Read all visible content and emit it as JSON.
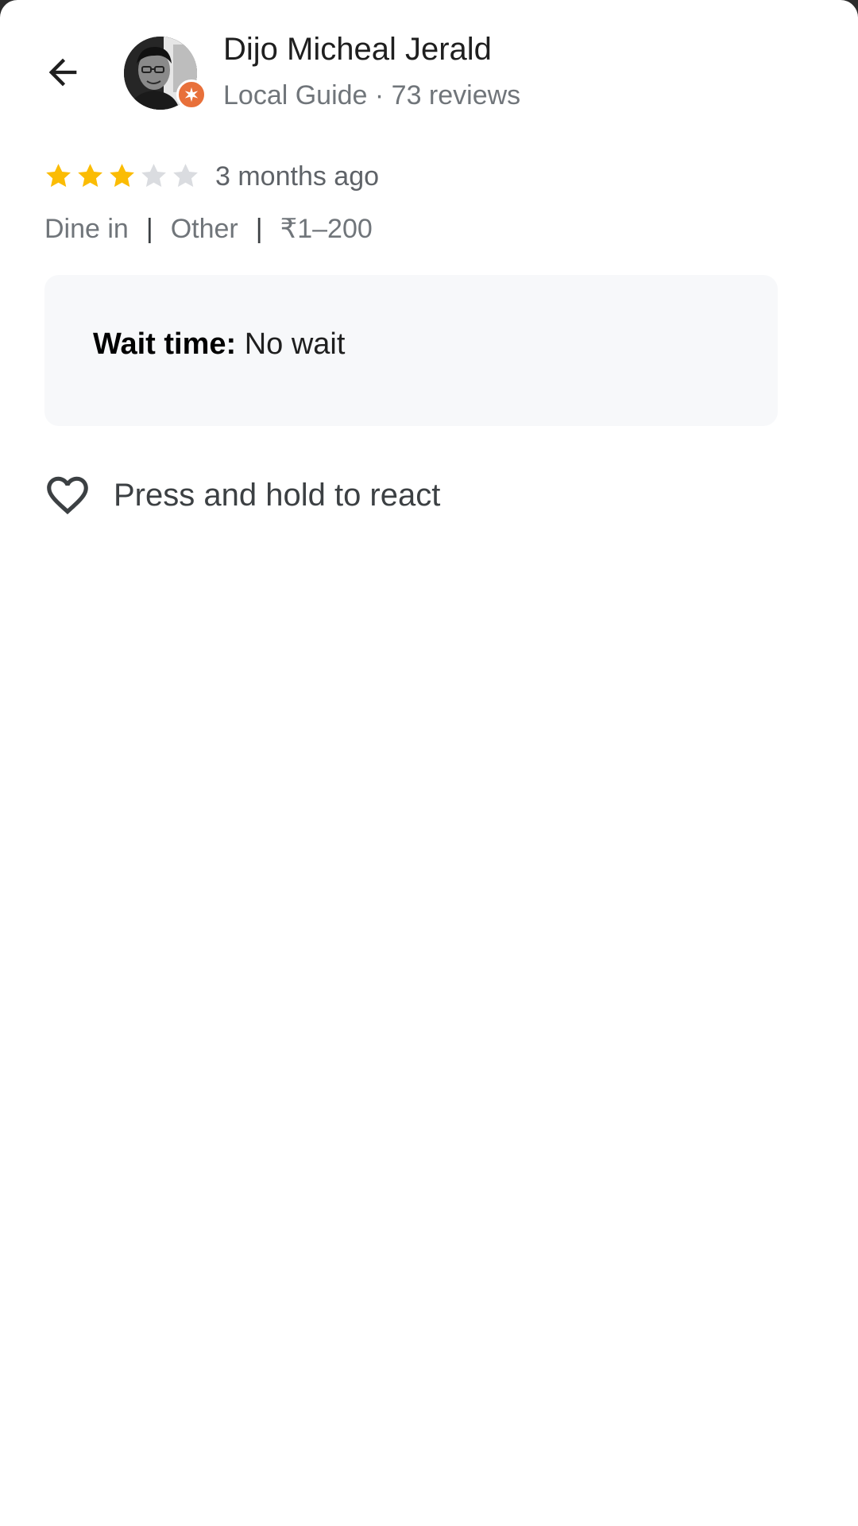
{
  "reviewer": {
    "name": "Dijo Micheal Jerald",
    "subtitle": "Local Guide · 73 reviews"
  },
  "review": {
    "rating": 3,
    "max_rating": 5,
    "time_ago": "3 months ago",
    "meta": {
      "service": "Dine in",
      "separator_1": "|",
      "meal_type": "Other",
      "separator_2": "|",
      "price": "₹1–200"
    },
    "attributes": {
      "label": "Wait time:",
      "value": "No wait"
    }
  },
  "reaction": {
    "label": "Press and hold to react"
  },
  "icons": {
    "back": "arrow-back-icon",
    "badge": "local-guide-star-icon",
    "react": "heart-outline-icon"
  },
  "colors": {
    "star_filled": "#FBBC04",
    "star_empty": "#DADCE0",
    "badge": "#E8703A",
    "card_background": "#F7F8FA"
  }
}
